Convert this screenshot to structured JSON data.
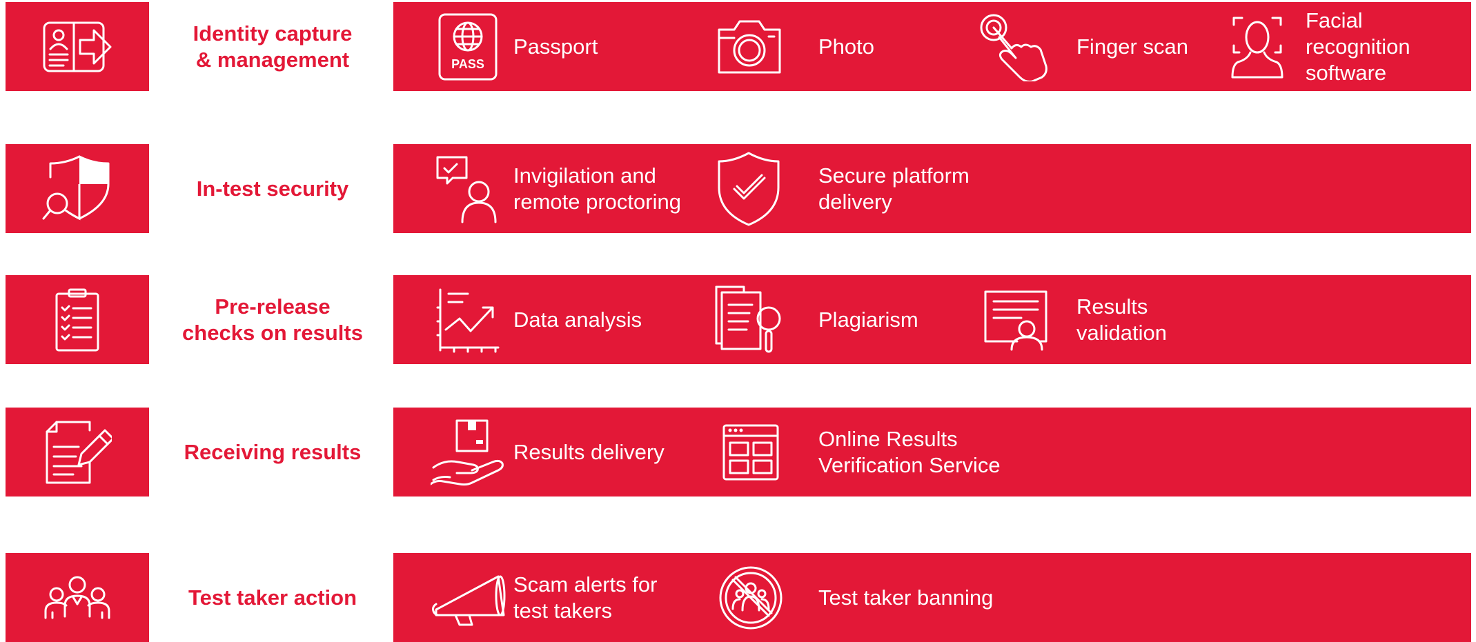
{
  "colors": {
    "brand_red": "#e31837",
    "white": "#ffffff"
  },
  "rows": [
    {
      "label": "Identity capture\n& management",
      "icon": "id-card-arrow-icon",
      "items": [
        {
          "label": "Passport",
          "icon": "passport-icon",
          "icon_text": "PASS"
        },
        {
          "label": "Photo",
          "icon": "camera-icon"
        },
        {
          "label": "Finger scan",
          "icon": "finger-touch-icon"
        },
        {
          "label": "Facial\nrecognition\nsoftware",
          "icon": "face-scan-icon"
        }
      ]
    },
    {
      "label": "In-test security",
      "icon": "shield-search-icon",
      "items": [
        {
          "label": "Invigilation and\nremote proctoring",
          "icon": "proctor-person-icon"
        },
        {
          "label": "Secure platform\ndelivery",
          "icon": "shield-check-icon"
        }
      ]
    },
    {
      "label": "Pre-release\nchecks on results",
      "icon": "clipboard-checklist-icon",
      "items": [
        {
          "label": "Data analysis",
          "icon": "trend-chart-icon"
        },
        {
          "label": "Plagiarism",
          "icon": "document-search-icon"
        },
        {
          "label": "Results\nvalidation",
          "icon": "certificate-icon"
        }
      ]
    },
    {
      "label": "Receiving results",
      "icon": "document-pencil-icon",
      "items": [
        {
          "label": "Results delivery",
          "icon": "hand-package-icon"
        },
        {
          "label": "Online Results\nVerification Service",
          "icon": "browser-window-icon"
        }
      ]
    },
    {
      "label": "Test taker action",
      "icon": "people-group-icon",
      "items": [
        {
          "label": "Scam alerts for\ntest takers",
          "icon": "megaphone-icon"
        },
        {
          "label": "Test taker banning",
          "icon": "people-banned-icon"
        }
      ]
    }
  ]
}
